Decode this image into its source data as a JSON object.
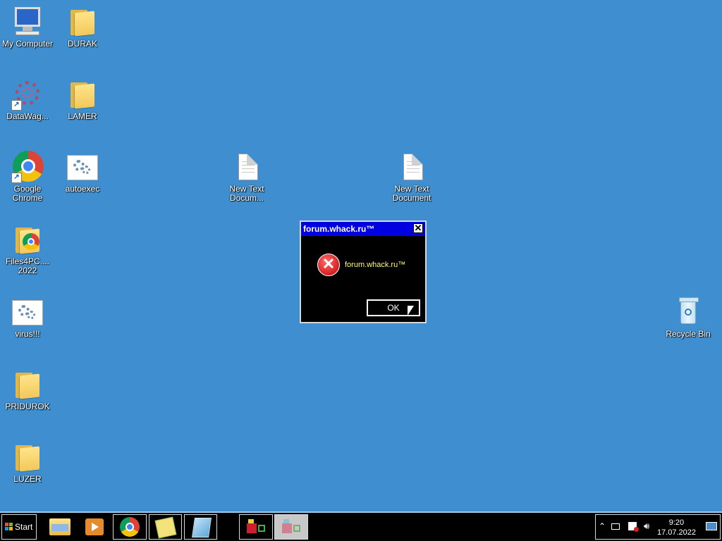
{
  "desktop": {
    "icons": [
      {
        "label": "My Computer",
        "icon": "computer-icon"
      },
      {
        "label": "DURAK",
        "icon": "folder-icon"
      },
      {
        "label": "DataWag...",
        "icon": "datawag-icon"
      },
      {
        "label": "LAMER",
        "icon": "folder-icon"
      },
      {
        "label": "Google Chrome",
        "icon": "chrome-icon"
      },
      {
        "label": "autoexec",
        "icon": "settings-file-icon"
      },
      {
        "label": "New Text Docum...",
        "icon": "text-document-icon"
      },
      {
        "label": "New Text Document",
        "icon": "text-document-icon"
      },
      {
        "label": "Files4PC.... 2022",
        "icon": "chrome-folder-icon"
      },
      {
        "label": "virus!!!",
        "icon": "settings-file-icon"
      },
      {
        "label": "PRIDUROK",
        "icon": "folder-icon"
      },
      {
        "label": "LUZER",
        "icon": "folder-icon"
      },
      {
        "label": "Recycle Bin",
        "icon": "recycle-bin-icon"
      }
    ]
  },
  "dialog": {
    "title": "forum.whack.ru™",
    "message": "forum.whack.ru™",
    "ok_label": "OK",
    "close_glyph": "✕",
    "colors": {
      "title_bg": "#0000e0",
      "body_bg": "#000000",
      "message_text": "#ffff66"
    }
  },
  "taskbar": {
    "start_label": "Start",
    "pinned": [
      "file-explorer-icon",
      "media-player-icon",
      "chrome-icon",
      "notes-icon",
      "notepad-icon"
    ],
    "running": [
      "app-window-icon",
      "app-window-icon"
    ],
    "clock": {
      "time": "9:20",
      "date": "17.07.2022"
    }
  },
  "colors": {
    "desktop_bg": "#3f8fd0",
    "taskbar_bg": "#000000"
  }
}
